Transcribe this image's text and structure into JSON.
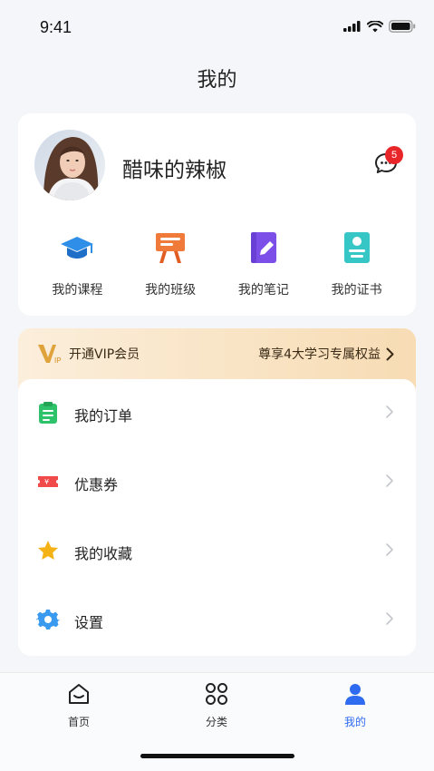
{
  "status_bar": {
    "time": "9:41"
  },
  "header": {
    "title": "我的"
  },
  "profile": {
    "username": "醋味的辣椒",
    "message_count": "5"
  },
  "quick_links": [
    {
      "label": "我的课程",
      "icon": "graduation-cap-icon",
      "color": "#2f8fe8"
    },
    {
      "label": "我的班级",
      "icon": "class-board-icon",
      "color": "#f07a3a"
    },
    {
      "label": "我的笔记",
      "icon": "notebook-icon",
      "color": "#7b4fe8"
    },
    {
      "label": "我的证书",
      "icon": "certificate-icon",
      "color": "#36c6c6"
    }
  ],
  "vip": {
    "label": "开通VIP会员",
    "benefit": "尊享4大学习专属权益"
  },
  "menu": [
    {
      "label": "我的订单",
      "icon": "order-clipboard-icon",
      "color": "#2ec26b"
    },
    {
      "label": "优惠券",
      "icon": "coupon-icon",
      "color": "#f04a4a"
    },
    {
      "label": "我的收藏",
      "icon": "star-icon",
      "color": "#f5b216"
    },
    {
      "label": "设置",
      "icon": "settings-gear-icon",
      "color": "#3a9af0"
    }
  ],
  "tabs": [
    {
      "label": "首页",
      "icon": "home-icon",
      "active": false
    },
    {
      "label": "分类",
      "icon": "category-icon",
      "active": false
    },
    {
      "label": "我的",
      "icon": "user-icon",
      "active": true
    }
  ],
  "colors": {
    "accent": "#2f6bf0",
    "background": "#f4f6f9",
    "vip_gradient_start": "#fbeedb",
    "vip_gradient_end": "#f7dcb4"
  }
}
